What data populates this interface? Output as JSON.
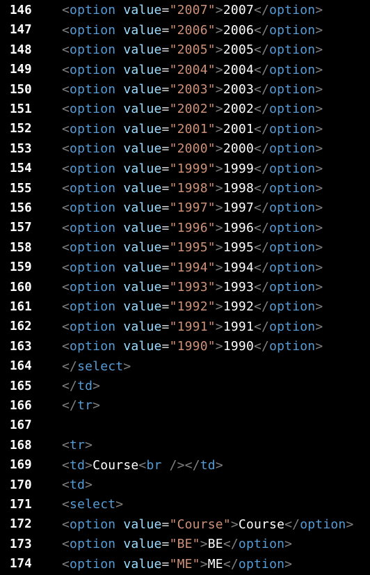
{
  "colors": {
    "background": "#000000",
    "line_number": "#ffffff",
    "punctuation": "#808080",
    "tag": "#569cd6",
    "attribute": "#9cdcfe",
    "equals": "#d4d4d4",
    "string": "#ce9178",
    "text": "#ffffff"
  },
  "lines": [
    {
      "num": "146",
      "tokens": [
        [
          "p",
          "<"
        ],
        [
          "t",
          "option"
        ],
        [
          "s",
          " "
        ],
        [
          "a",
          "value"
        ],
        [
          "e",
          "="
        ],
        [
          "q",
          "\"2007\""
        ],
        [
          "p",
          ">"
        ],
        [
          "x",
          "2007"
        ],
        [
          "p",
          "</"
        ],
        [
          "t",
          "option"
        ],
        [
          "p",
          ">"
        ]
      ]
    },
    {
      "num": "147",
      "tokens": [
        [
          "p",
          "<"
        ],
        [
          "t",
          "option"
        ],
        [
          "s",
          " "
        ],
        [
          "a",
          "value"
        ],
        [
          "e",
          "="
        ],
        [
          "q",
          "\"2006\""
        ],
        [
          "p",
          ">"
        ],
        [
          "x",
          "2006"
        ],
        [
          "p",
          "</"
        ],
        [
          "t",
          "option"
        ],
        [
          "p",
          ">"
        ]
      ]
    },
    {
      "num": "148",
      "tokens": [
        [
          "p",
          "<"
        ],
        [
          "t",
          "option"
        ],
        [
          "s",
          " "
        ],
        [
          "a",
          "value"
        ],
        [
          "e",
          "="
        ],
        [
          "q",
          "\"2005\""
        ],
        [
          "p",
          ">"
        ],
        [
          "x",
          "2005"
        ],
        [
          "p",
          "</"
        ],
        [
          "t",
          "option"
        ],
        [
          "p",
          ">"
        ]
      ]
    },
    {
      "num": "149",
      "tokens": [
        [
          "p",
          "<"
        ],
        [
          "t",
          "option"
        ],
        [
          "s",
          " "
        ],
        [
          "a",
          "value"
        ],
        [
          "e",
          "="
        ],
        [
          "q",
          "\"2004\""
        ],
        [
          "p",
          ">"
        ],
        [
          "x",
          "2004"
        ],
        [
          "p",
          "</"
        ],
        [
          "t",
          "option"
        ],
        [
          "p",
          ">"
        ]
      ]
    },
    {
      "num": "150",
      "tokens": [
        [
          "p",
          "<"
        ],
        [
          "t",
          "option"
        ],
        [
          "s",
          " "
        ],
        [
          "a",
          "value"
        ],
        [
          "e",
          "="
        ],
        [
          "q",
          "\"2003\""
        ],
        [
          "p",
          ">"
        ],
        [
          "x",
          "2003"
        ],
        [
          "p",
          "</"
        ],
        [
          "t",
          "option"
        ],
        [
          "p",
          ">"
        ]
      ]
    },
    {
      "num": "151",
      "tokens": [
        [
          "p",
          "<"
        ],
        [
          "t",
          "option"
        ],
        [
          "s",
          " "
        ],
        [
          "a",
          "value"
        ],
        [
          "e",
          "="
        ],
        [
          "q",
          "\"2002\""
        ],
        [
          "p",
          ">"
        ],
        [
          "x",
          "2002"
        ],
        [
          "p",
          "</"
        ],
        [
          "t",
          "option"
        ],
        [
          "p",
          ">"
        ]
      ]
    },
    {
      "num": "152",
      "tokens": [
        [
          "p",
          "<"
        ],
        [
          "t",
          "option"
        ],
        [
          "s",
          " "
        ],
        [
          "a",
          "value"
        ],
        [
          "e",
          "="
        ],
        [
          "q",
          "\"2001\""
        ],
        [
          "p",
          ">"
        ],
        [
          "x",
          "2001"
        ],
        [
          "p",
          "</"
        ],
        [
          "t",
          "option"
        ],
        [
          "p",
          ">"
        ]
      ]
    },
    {
      "num": "153",
      "tokens": [
        [
          "p",
          "<"
        ],
        [
          "t",
          "option"
        ],
        [
          "s",
          " "
        ],
        [
          "a",
          "value"
        ],
        [
          "e",
          "="
        ],
        [
          "q",
          "\"2000\""
        ],
        [
          "p",
          ">"
        ],
        [
          "x",
          "2000"
        ],
        [
          "p",
          "</"
        ],
        [
          "t",
          "option"
        ],
        [
          "p",
          ">"
        ]
      ]
    },
    {
      "num": "154",
      "tokens": [
        [
          "p",
          "<"
        ],
        [
          "t",
          "option"
        ],
        [
          "s",
          " "
        ],
        [
          "a",
          "value"
        ],
        [
          "e",
          "="
        ],
        [
          "q",
          "\"1999\""
        ],
        [
          "p",
          ">"
        ],
        [
          "x",
          "1999"
        ],
        [
          "p",
          "</"
        ],
        [
          "t",
          "option"
        ],
        [
          "p",
          ">"
        ]
      ]
    },
    {
      "num": "155",
      "tokens": [
        [
          "p",
          "<"
        ],
        [
          "t",
          "option"
        ],
        [
          "s",
          " "
        ],
        [
          "a",
          "value"
        ],
        [
          "e",
          "="
        ],
        [
          "q",
          "\"1998\""
        ],
        [
          "p",
          ">"
        ],
        [
          "x",
          "1998"
        ],
        [
          "p",
          "</"
        ],
        [
          "t",
          "option"
        ],
        [
          "p",
          ">"
        ]
      ]
    },
    {
      "num": "156",
      "tokens": [
        [
          "p",
          "<"
        ],
        [
          "t",
          "option"
        ],
        [
          "s",
          " "
        ],
        [
          "a",
          "value"
        ],
        [
          "e",
          "="
        ],
        [
          "q",
          "\"1997\""
        ],
        [
          "p",
          ">"
        ],
        [
          "x",
          "1997"
        ],
        [
          "p",
          "</"
        ],
        [
          "t",
          "option"
        ],
        [
          "p",
          ">"
        ]
      ]
    },
    {
      "num": "157",
      "tokens": [
        [
          "p",
          "<"
        ],
        [
          "t",
          "option"
        ],
        [
          "s",
          " "
        ],
        [
          "a",
          "value"
        ],
        [
          "e",
          "="
        ],
        [
          "q",
          "\"1996\""
        ],
        [
          "p",
          ">"
        ],
        [
          "x",
          "1996"
        ],
        [
          "p",
          "</"
        ],
        [
          "t",
          "option"
        ],
        [
          "p",
          ">"
        ]
      ]
    },
    {
      "num": "158",
      "tokens": [
        [
          "p",
          "<"
        ],
        [
          "t",
          "option"
        ],
        [
          "s",
          " "
        ],
        [
          "a",
          "value"
        ],
        [
          "e",
          "="
        ],
        [
          "q",
          "\"1995\""
        ],
        [
          "p",
          ">"
        ],
        [
          "x",
          "1995"
        ],
        [
          "p",
          "</"
        ],
        [
          "t",
          "option"
        ],
        [
          "p",
          ">"
        ]
      ]
    },
    {
      "num": "159",
      "tokens": [
        [
          "p",
          "<"
        ],
        [
          "t",
          "option"
        ],
        [
          "s",
          " "
        ],
        [
          "a",
          "value"
        ],
        [
          "e",
          "="
        ],
        [
          "q",
          "\"1994\""
        ],
        [
          "p",
          ">"
        ],
        [
          "x",
          "1994"
        ],
        [
          "p",
          "</"
        ],
        [
          "t",
          "option"
        ],
        [
          "p",
          ">"
        ]
      ]
    },
    {
      "num": "160",
      "tokens": [
        [
          "p",
          "<"
        ],
        [
          "t",
          "option"
        ],
        [
          "s",
          " "
        ],
        [
          "a",
          "value"
        ],
        [
          "e",
          "="
        ],
        [
          "q",
          "\"1993\""
        ],
        [
          "p",
          ">"
        ],
        [
          "x",
          "1993"
        ],
        [
          "p",
          "</"
        ],
        [
          "t",
          "option"
        ],
        [
          "p",
          ">"
        ]
      ]
    },
    {
      "num": "161",
      "tokens": [
        [
          "p",
          "<"
        ],
        [
          "t",
          "option"
        ],
        [
          "s",
          " "
        ],
        [
          "a",
          "value"
        ],
        [
          "e",
          "="
        ],
        [
          "q",
          "\"1992\""
        ],
        [
          "p",
          ">"
        ],
        [
          "x",
          "1992"
        ],
        [
          "p",
          "</"
        ],
        [
          "t",
          "option"
        ],
        [
          "p",
          ">"
        ]
      ]
    },
    {
      "num": "162",
      "tokens": [
        [
          "p",
          "<"
        ],
        [
          "t",
          "option"
        ],
        [
          "s",
          " "
        ],
        [
          "a",
          "value"
        ],
        [
          "e",
          "="
        ],
        [
          "q",
          "\"1991\""
        ],
        [
          "p",
          ">"
        ],
        [
          "x",
          "1991"
        ],
        [
          "p",
          "</"
        ],
        [
          "t",
          "option"
        ],
        [
          "p",
          ">"
        ]
      ]
    },
    {
      "num": "163",
      "tokens": [
        [
          "p",
          "<"
        ],
        [
          "t",
          "option"
        ],
        [
          "s",
          " "
        ],
        [
          "a",
          "value"
        ],
        [
          "e",
          "="
        ],
        [
          "q",
          "\"1990\""
        ],
        [
          "p",
          ">"
        ],
        [
          "x",
          "1990"
        ],
        [
          "p",
          "</"
        ],
        [
          "t",
          "option"
        ],
        [
          "p",
          ">"
        ]
      ]
    },
    {
      "num": "164",
      "tokens": [
        [
          "p",
          "</"
        ],
        [
          "t",
          "select"
        ],
        [
          "p",
          ">"
        ]
      ]
    },
    {
      "num": "165",
      "tokens": [
        [
          "p",
          "</"
        ],
        [
          "t",
          "td"
        ],
        [
          "p",
          ">"
        ]
      ]
    },
    {
      "num": "166",
      "tokens": [
        [
          "p",
          "</"
        ],
        [
          "t",
          "tr"
        ],
        [
          "p",
          ">"
        ]
      ]
    },
    {
      "num": "167",
      "tokens": []
    },
    {
      "num": "168",
      "tokens": [
        [
          "p",
          "<"
        ],
        [
          "t",
          "tr"
        ],
        [
          "p",
          ">"
        ]
      ]
    },
    {
      "num": "169",
      "tokens": [
        [
          "p",
          "<"
        ],
        [
          "t",
          "td"
        ],
        [
          "p",
          ">"
        ],
        [
          "x",
          "Course"
        ],
        [
          "p",
          "<"
        ],
        [
          "t",
          "br"
        ],
        [
          "s",
          " "
        ],
        [
          "p",
          "/></"
        ],
        [
          "t",
          "td"
        ],
        [
          "p",
          ">"
        ]
      ]
    },
    {
      "num": "170",
      "tokens": [
        [
          "p",
          "<"
        ],
        [
          "t",
          "td"
        ],
        [
          "p",
          ">"
        ]
      ]
    },
    {
      "num": "171",
      "tokens": [
        [
          "p",
          "<"
        ],
        [
          "t",
          "select"
        ],
        [
          "p",
          ">"
        ]
      ]
    },
    {
      "num": "172",
      "tokens": [
        [
          "p",
          "<"
        ],
        [
          "t",
          "option"
        ],
        [
          "s",
          " "
        ],
        [
          "a",
          "value"
        ],
        [
          "e",
          "="
        ],
        [
          "q",
          "\"Course\""
        ],
        [
          "p",
          ">"
        ],
        [
          "x",
          "Course"
        ],
        [
          "p",
          "</"
        ],
        [
          "t",
          "option"
        ],
        [
          "p",
          ">"
        ]
      ]
    },
    {
      "num": "173",
      "tokens": [
        [
          "p",
          "<"
        ],
        [
          "t",
          "option"
        ],
        [
          "s",
          " "
        ],
        [
          "a",
          "value"
        ],
        [
          "e",
          "="
        ],
        [
          "q",
          "\"BE\""
        ],
        [
          "p",
          ">"
        ],
        [
          "x",
          "BE"
        ],
        [
          "p",
          "</"
        ],
        [
          "t",
          "option"
        ],
        [
          "p",
          ">"
        ]
      ]
    },
    {
      "num": "174",
      "tokens": [
        [
          "p",
          "<"
        ],
        [
          "t",
          "option"
        ],
        [
          "s",
          " "
        ],
        [
          "a",
          "value"
        ],
        [
          "e",
          "="
        ],
        [
          "q",
          "\"ME\""
        ],
        [
          "p",
          ">"
        ],
        [
          "x",
          "ME"
        ],
        [
          "p",
          "</"
        ],
        [
          "t",
          "option"
        ],
        [
          "p",
          ">"
        ]
      ]
    }
  ]
}
